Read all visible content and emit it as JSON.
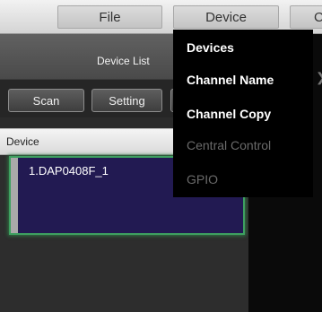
{
  "menubar": {
    "file_label": "File",
    "device_label": "Device",
    "more_label": "C"
  },
  "device_menu": {
    "items": [
      {
        "label": "Devices",
        "enabled": true
      },
      {
        "label": "Channel Name",
        "enabled": true
      },
      {
        "label": "Channel Copy",
        "enabled": true
      },
      {
        "label": "Central Control",
        "enabled": false
      },
      {
        "label": "GPIO",
        "enabled": false
      }
    ]
  },
  "panel": {
    "title": "Device List",
    "buttons": {
      "scan": "Scan",
      "setting": "Setting"
    },
    "column_header": "Device",
    "devices": [
      {
        "label": "1.DAP0408F_1"
      }
    ]
  },
  "colors": {
    "selected_row_bg": "#221a52",
    "selected_row_border": "#3ea060",
    "menu_bg": "#000000",
    "disabled_text": "#6a6a6a"
  },
  "icons": {
    "expand": "chevron-right-icon"
  }
}
